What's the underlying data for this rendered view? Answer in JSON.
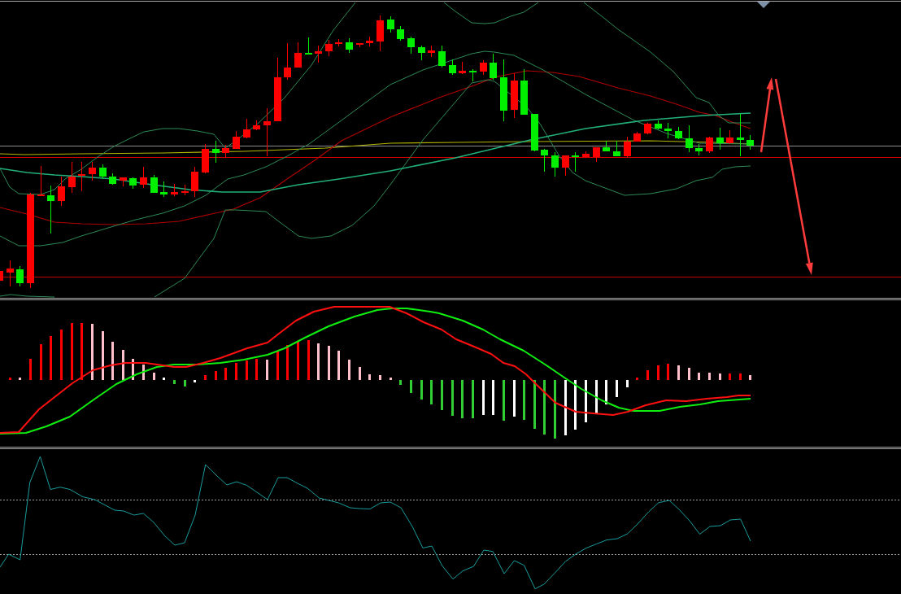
{
  "panels": [
    {
      "kind": "candlestick"
    },
    {
      "kind": "macd"
    },
    {
      "kind": "oscillator"
    }
  ]
}
